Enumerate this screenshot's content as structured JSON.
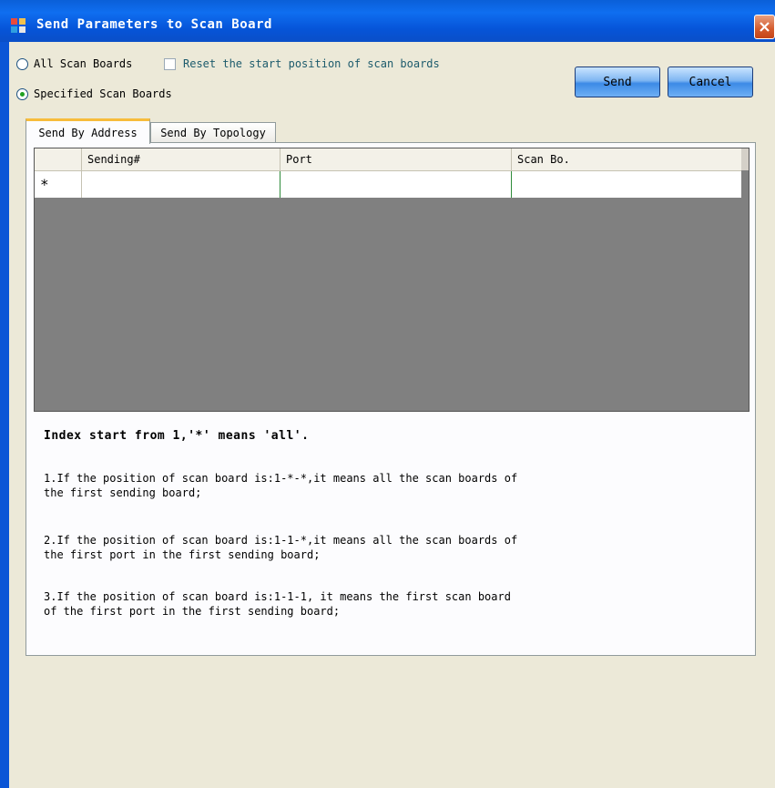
{
  "window": {
    "title": "Send Parameters to Scan Board"
  },
  "options": {
    "all_scan_boards": "All Scan Boards",
    "reset_start_position": "Reset the start position of scan boards",
    "specified_scan_boards": "Specified Scan Boards",
    "selected": "specified"
  },
  "buttons": {
    "send": "Send",
    "cancel": "Cancel"
  },
  "tabs": [
    {
      "label": "Send By Address",
      "active": true
    },
    {
      "label": "Send By Topology",
      "active": false
    }
  ],
  "grid": {
    "columns": [
      "Sending#",
      "Port",
      "Scan Bo."
    ],
    "new_row_marker": "*"
  },
  "info": {
    "title": "Index start from 1,'*' means 'all'.",
    "item1_line1": "1.If the position of scan board is:1-*-*,it means all the scan boards of",
    "item1_line2": "the first sending board;",
    "item2_line1": "2.If the position of scan board is:1-1-*,it means all the scan boards of",
    "item2_line2": "the first port in the first sending board;",
    "item3_line1": "3.If the position of scan board is:1-1-1, it means the first scan board",
    "item3_line2": "of the first port in the first sending board;"
  },
  "colors": {
    "titlebar": "#0a5fd8",
    "client_bg": "#ece9d8",
    "grid_bg": "#808080",
    "tab_highlight": "#f7bc3b"
  }
}
